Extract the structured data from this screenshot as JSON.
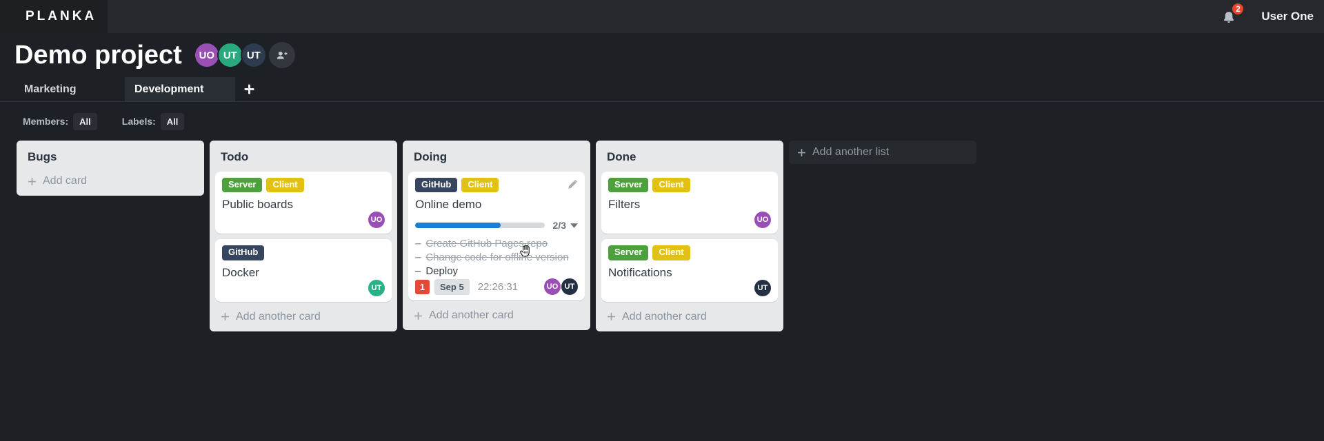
{
  "app": {
    "logo": "PLANKA",
    "user_name": "User One",
    "notifications_count": "2"
  },
  "project": {
    "title": "Demo project",
    "members": [
      {
        "initials": "UO",
        "color": "#9a4fb5"
      },
      {
        "initials": "UT",
        "color": "#28a97e"
      },
      {
        "initials": "UT",
        "color": "#2e3b4e"
      }
    ]
  },
  "tabs": {
    "items": [
      {
        "label": "Marketing",
        "active": false
      },
      {
        "label": "Development",
        "active": true
      }
    ]
  },
  "filters": {
    "members_label": "Members:",
    "members_value": "All",
    "labels_label": "Labels:",
    "labels_value": "All"
  },
  "board": {
    "task_marker": "–",
    "add_list_label": "Add another list",
    "lists": [
      {
        "title": "Bugs",
        "add_label": "Add card",
        "cards": []
      },
      {
        "title": "Todo",
        "add_label": "Add another card",
        "cards": [
          {
            "title": "Public boards",
            "labels": [
              {
                "text": "Server",
                "color": "#4da13c"
              },
              {
                "text": "Client",
                "color": "#e2c014"
              }
            ],
            "members": [
              {
                "initials": "UO",
                "color": "#9a4fb5"
              }
            ]
          },
          {
            "title": "Docker",
            "labels": [
              {
                "text": "GitHub",
                "color": "#37455e"
              }
            ],
            "members": [
              {
                "initials": "UT",
                "color": "#28b287"
              }
            ]
          }
        ]
      },
      {
        "title": "Doing",
        "add_label": "Add another card",
        "cards": [
          {
            "title": "Online demo",
            "labels": [
              {
                "text": "GitHub",
                "color": "#37455e"
              },
              {
                "text": "Client",
                "color": "#e2c014"
              }
            ],
            "progress": {
              "completed": 2,
              "total": 3,
              "label": "2/3",
              "percent": "66%",
              "bar_color": "#1a7fd4"
            },
            "tasks": [
              {
                "text": "Create GitHub Pages repo",
                "completed": true
              },
              {
                "text": "Change code for offline version",
                "completed": true
              },
              {
                "text": "Deploy",
                "completed": false
              }
            ],
            "notification_count": "1",
            "due_date": "Sep 5",
            "timer": "22:26:31",
            "members": [
              {
                "initials": "UO",
                "color": "#9a4fb5"
              },
              {
                "initials": "UT",
                "color": "#243043"
              }
            ]
          }
        ]
      },
      {
        "title": "Done",
        "add_label": "Add another card",
        "cards": [
          {
            "title": "Filters",
            "labels": [
              {
                "text": "Server",
                "color": "#4da13c"
              },
              {
                "text": "Client",
                "color": "#e2c014"
              }
            ],
            "members": [
              {
                "initials": "UO",
                "color": "#9a4fb5"
              }
            ]
          },
          {
            "title": "Notifications",
            "labels": [
              {
                "text": "Server",
                "color": "#4da13c"
              },
              {
                "text": "Client",
                "color": "#e2c014"
              }
            ],
            "members": [
              {
                "initials": "UT",
                "color": "#243043"
              }
            ]
          }
        ]
      }
    ]
  }
}
